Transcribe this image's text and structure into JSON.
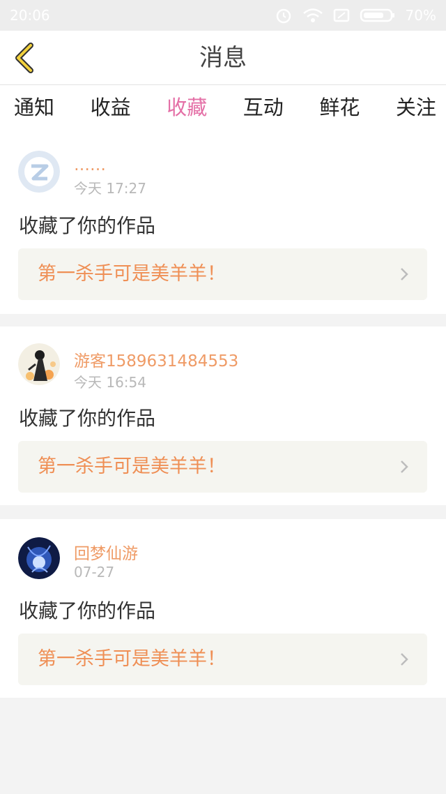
{
  "status_bar": {
    "time": "20:06",
    "battery": "70%"
  },
  "header": {
    "title": "消息"
  },
  "tabs": [
    {
      "label": "通知",
      "active": false
    },
    {
      "label": "收益",
      "active": false
    },
    {
      "label": "收藏",
      "active": true
    },
    {
      "label": "互动",
      "active": false
    },
    {
      "label": "鲜花",
      "active": false
    },
    {
      "label": "关注",
      "active": false
    }
  ],
  "messages": [
    {
      "username": "……",
      "time": "今天 17:27",
      "action": "收藏了你的作品",
      "work_title": "第一杀手可是美羊羊！",
      "avatar": "default-avatar"
    },
    {
      "username": "游客1589631484553",
      "time": "今天 16:54",
      "action": "收藏了你的作品",
      "work_title": "第一杀手可是美羊羊！",
      "avatar": "girl-avatar"
    },
    {
      "username": "回梦仙游",
      "time": "07-27",
      "action": "收藏了你的作品",
      "work_title": "第一杀手可是美羊羊！",
      "avatar": "blue-art-avatar"
    }
  ],
  "colors": {
    "accent_pink": "#e46fa6",
    "name_orange": "#ef9b66",
    "work_orange": "#ef8f55",
    "back_yellow": "#f2d13c"
  }
}
